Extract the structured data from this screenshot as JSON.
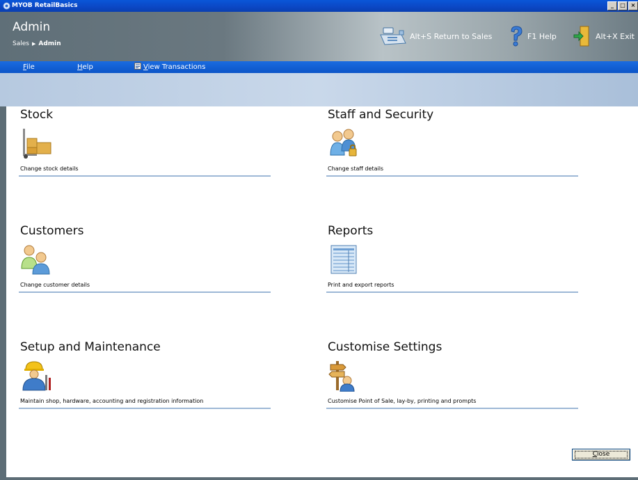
{
  "window": {
    "title": "MYOB RetailBasics",
    "controls": [
      "_",
      "□",
      "×"
    ]
  },
  "header": {
    "page_title": "Admin",
    "breadcrumb": {
      "parent": "Sales",
      "current": "Admin"
    },
    "actions": {
      "return_to_sales": "Alt+S Return to Sales",
      "help": "F1 Help",
      "exit": "Alt+X Exit"
    }
  },
  "menu": {
    "file_pre": "",
    "file_u": "F",
    "file_post": "ile",
    "help_pre": "",
    "help_u": "H",
    "help_post": "elp",
    "view_pre": "",
    "view_u": "V",
    "view_post": "iew Transactions"
  },
  "tiles": [
    {
      "title": "Stock",
      "description": "Change stock details",
      "icon": "stock-trolley-icon"
    },
    {
      "title": "Staff and Security",
      "description": "Change staff details",
      "icon": "staff-security-icon"
    },
    {
      "title": "Customers",
      "description": "Change customer details",
      "icon": "customers-icon"
    },
    {
      "title": "Reports",
      "description": "Print and export reports",
      "icon": "reports-icon"
    },
    {
      "title": "Setup and Maintenance",
      "description": "Maintain shop, hardware, accounting and registration information",
      "icon": "setup-maintenance-icon"
    },
    {
      "title": "Customise Settings",
      "description": "Customise Point of Sale, lay-by, printing and prompts",
      "icon": "customise-settings-icon"
    }
  ],
  "footer": {
    "close_pre": "",
    "close_u": "C",
    "close_post": "lose"
  },
  "colors": {
    "titlebar": "#0b47c4",
    "menubar": "#0c55c8",
    "header_gray": "#6a7880",
    "band": "#c9d8ea",
    "tile_underline": "#9db7d6"
  }
}
